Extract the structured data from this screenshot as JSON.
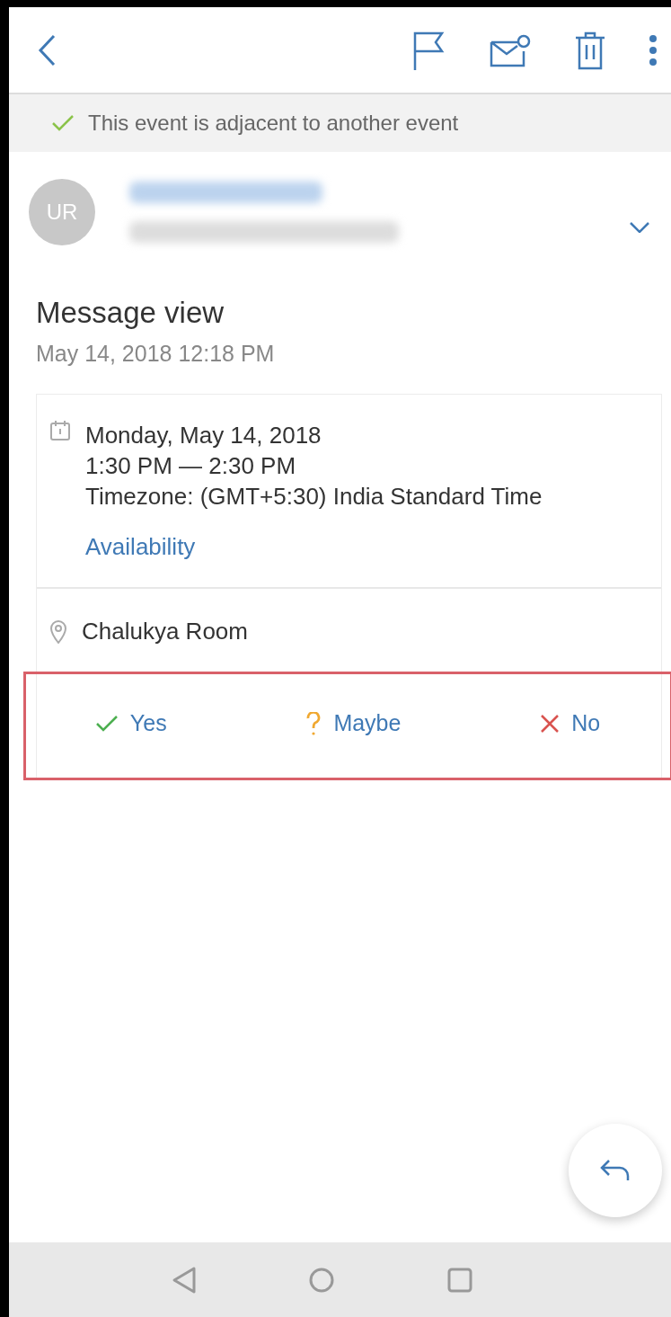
{
  "toolbar": {
    "actions": [
      {
        "kind": "flag"
      },
      {
        "kind": "mail"
      },
      {
        "kind": "delete"
      },
      {
        "kind": "more"
      }
    ]
  },
  "banner": {
    "text": "This event is adjacent to another event"
  },
  "sender": {
    "initials": "UR"
  },
  "message": {
    "subject": "Message view",
    "date": "May 14, 2018 12:18 PM"
  },
  "event": {
    "date": "Monday, May 14, 2018",
    "time": "1:30 PM — 2:30 PM",
    "timezone": "Timezone: (GMT+5:30) India Standard Time",
    "availability_link": "Availability",
    "location": "Chalukya Room"
  },
  "responses": [
    {
      "kind": "yes",
      "label": "Yes"
    },
    {
      "kind": "maybe",
      "label": "Maybe"
    },
    {
      "kind": "no",
      "label": "No"
    }
  ]
}
